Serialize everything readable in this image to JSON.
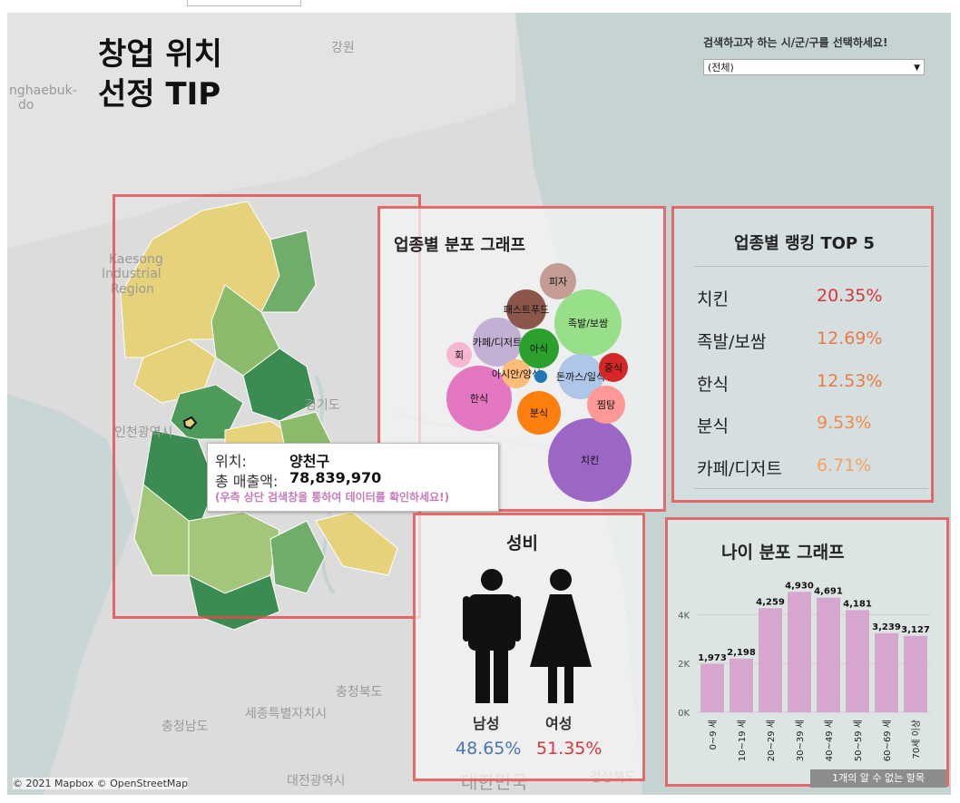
{
  "map": {
    "labels": [
      "강원",
      "경기도",
      "충청북도",
      "세종특별자치시",
      "충청남도",
      "대전광역시",
      "대한민국",
      "경상북도",
      "인천광역시",
      "Kaesong",
      "Industrial",
      "Region",
      "nghaebuk-",
      "do"
    ],
    "copyright": "© 2021 Mapbox © OpenStreetMap"
  },
  "title": {
    "line1": "창업 위치",
    "line2": "선정 TIP"
  },
  "filter": {
    "label": "검색하고자 하는 시/군/구를 선택하세요!",
    "value": "(전체)"
  },
  "category_bubbles": {
    "title": "업종별 분포 그래프",
    "items": [
      {
        "label": "치킨",
        "color": "#9b66c6"
      },
      {
        "label": "족발/보쌈",
        "color": "#98df8a"
      },
      {
        "label": "한식",
        "color": "#e377c2"
      },
      {
        "label": "분식",
        "color": "#ff7f0e"
      },
      {
        "label": "카페/디저트",
        "color": "#c5b0d5"
      },
      {
        "label": "돈까스/일식",
        "color": "#aec7e8"
      },
      {
        "label": "패스트푸드",
        "color": "#8c564b"
      },
      {
        "label": "피자",
        "color": "#c49c94"
      },
      {
        "label": "아식",
        "color": "#2ca02c"
      },
      {
        "label": "찜탕",
        "color": "#ff9896"
      },
      {
        "label": "중식",
        "color": "#d62728"
      },
      {
        "label": "회",
        "color": "#f7b6d2"
      },
      {
        "label": "아시안/양식",
        "color": "#ffbb78"
      },
      {
        "label": "",
        "color": "#1f77b4"
      }
    ]
  },
  "ranking": {
    "title": "업종별 랭킹 TOP 5",
    "items": [
      {
        "name": "치킨",
        "value": "20.35%",
        "color": "#d8363c"
      },
      {
        "name": "족발/보쌈",
        "value": "12.69%",
        "color": "#ea7a45"
      },
      {
        "name": "한식",
        "value": "12.53%",
        "color": "#ea7a45"
      },
      {
        "name": "분식",
        "value": "9.53%",
        "color": "#f08a4a"
      },
      {
        "name": "카페/디저트",
        "value": "6.71%",
        "color": "#f2a35e"
      }
    ]
  },
  "tooltip": {
    "loc_key": "위치:",
    "loc_val": "양천구",
    "sales_key": "총 매출액:",
    "sales_val": "78,839,970",
    "note": "(우측 상단 검색창을 통하여 데이터를 확인하세요!)"
  },
  "gender": {
    "title": "성비",
    "male_label": "남성",
    "male_value": "48.65%",
    "male_color": "#4a74b4",
    "female_label": "여성",
    "female_value": "51.35%",
    "female_color": "#d8363c"
  },
  "chart_data": {
    "type": "bar",
    "title": "나이 분포 그래프",
    "categories": [
      "0~9 세",
      "10~19 세",
      "20~29 세",
      "30~39 세",
      "40~49 세",
      "50~59 세",
      "60~69 세",
      "70세 이상"
    ],
    "values": [
      1973,
      2198,
      4259,
      4930,
      4691,
      4181,
      3239,
      3127
    ],
    "value_labels": [
      "1,973",
      "2,198",
      "4,259",
      "4,930",
      "4,691",
      "4,181",
      "3,239",
      "3,127"
    ],
    "yticks": [
      "0K",
      "2K",
      "4K"
    ],
    "ylim": [
      0,
      5200
    ],
    "bar_color": "#d7a6cf",
    "grid": true
  },
  "unknown_items": "1개의 알 수 없는 항목"
}
